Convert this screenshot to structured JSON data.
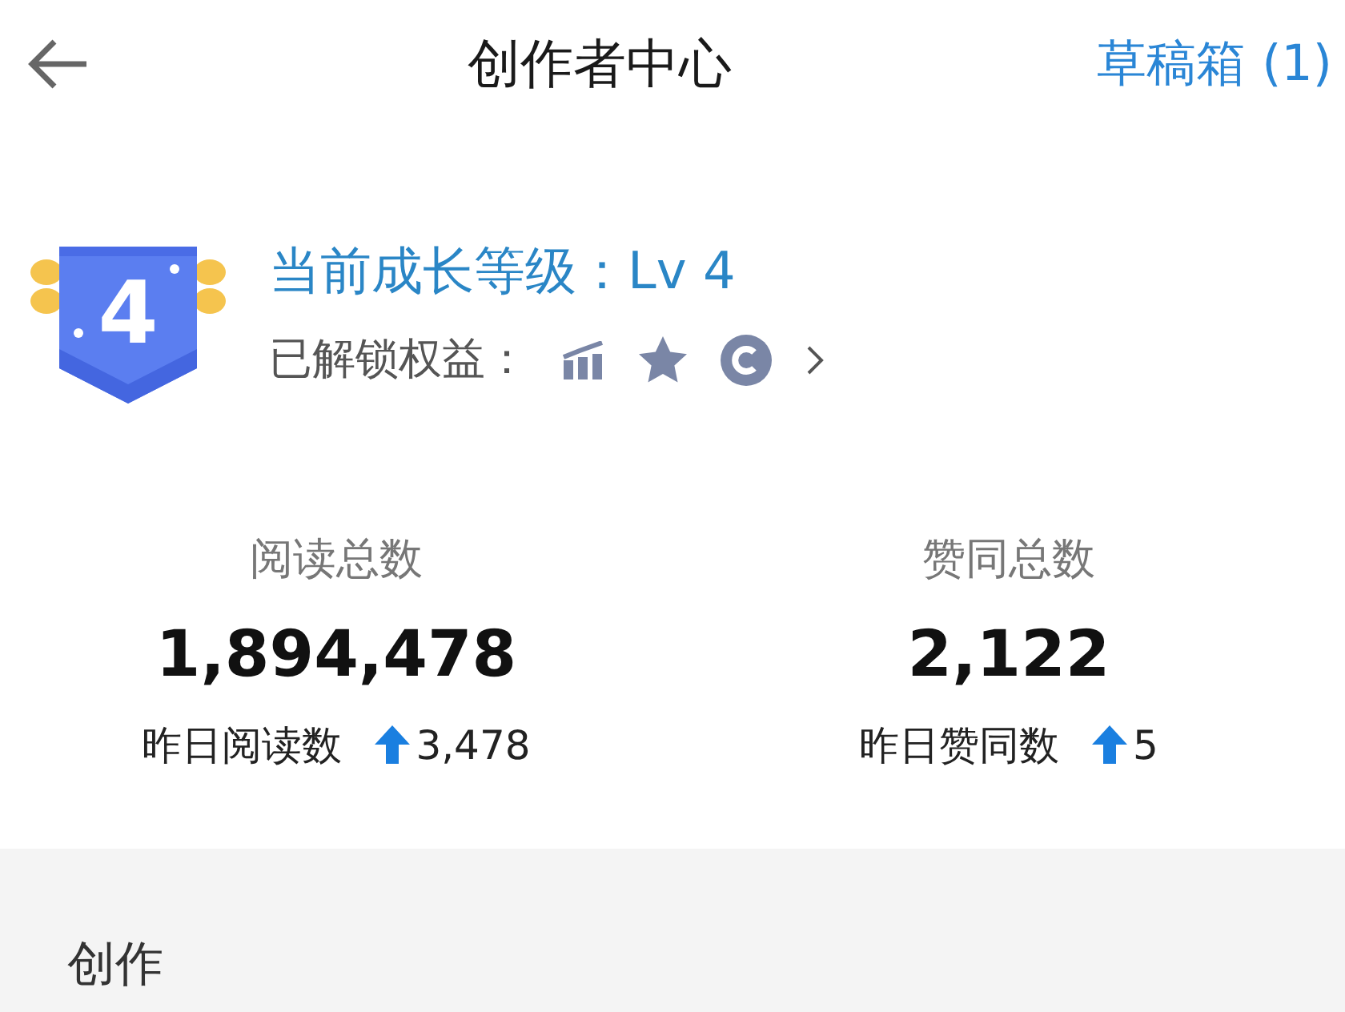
{
  "header": {
    "title": "创作者中心",
    "drafts": "草稿箱 (1)"
  },
  "level": {
    "badge": "4",
    "title": "当前成长等级：Lv 4",
    "perks_label": "已解锁权益："
  },
  "stats": [
    {
      "label": "阅读总数",
      "value": "1,894,478",
      "yesterday_label": "昨日阅读数",
      "yesterday_value": "3,478"
    },
    {
      "label": "赞同总数",
      "value": "2,122",
      "yesterday_label": "昨日赞同数",
      "yesterday_value": "5"
    }
  ],
  "section": {
    "title": "创作"
  }
}
